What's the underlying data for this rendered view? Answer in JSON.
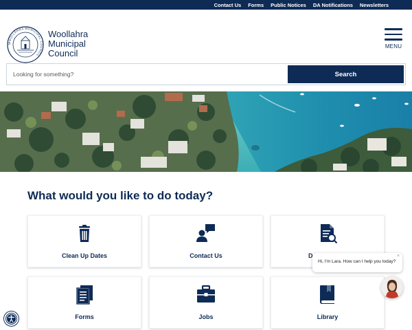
{
  "topnav": {
    "items": [
      "Contact Us",
      "Forms",
      "Public Notices",
      "DA Notifications",
      "Newsletters"
    ]
  },
  "brand": {
    "line1": "Woollahra",
    "line2": "Municipal",
    "line3": "Council",
    "seal_text": "WOOLLAHRA MUNICIPAL COUNCIL"
  },
  "menu": {
    "label": "MENU"
  },
  "search": {
    "placeholder": "Looking for something?",
    "button": "Search"
  },
  "main": {
    "heading": "What would you like to do today?",
    "cards": [
      {
        "label": "Clean Up Dates",
        "icon": "trash-icon"
      },
      {
        "label": "Contact Us",
        "icon": "contact-chat-icon"
      },
      {
        "label": "DAs - Search",
        "icon": "document-search-icon"
      },
      {
        "label": "Forms",
        "icon": "forms-icon"
      },
      {
        "label": "Jobs",
        "icon": "briefcase-icon"
      },
      {
        "label": "Library",
        "icon": "book-icon"
      }
    ]
  },
  "chat": {
    "message": "Hi, I'm Lara. How can I help you today?",
    "close": "×"
  },
  "colors": {
    "navy": "#0e2b56",
    "white": "#ffffff"
  }
}
